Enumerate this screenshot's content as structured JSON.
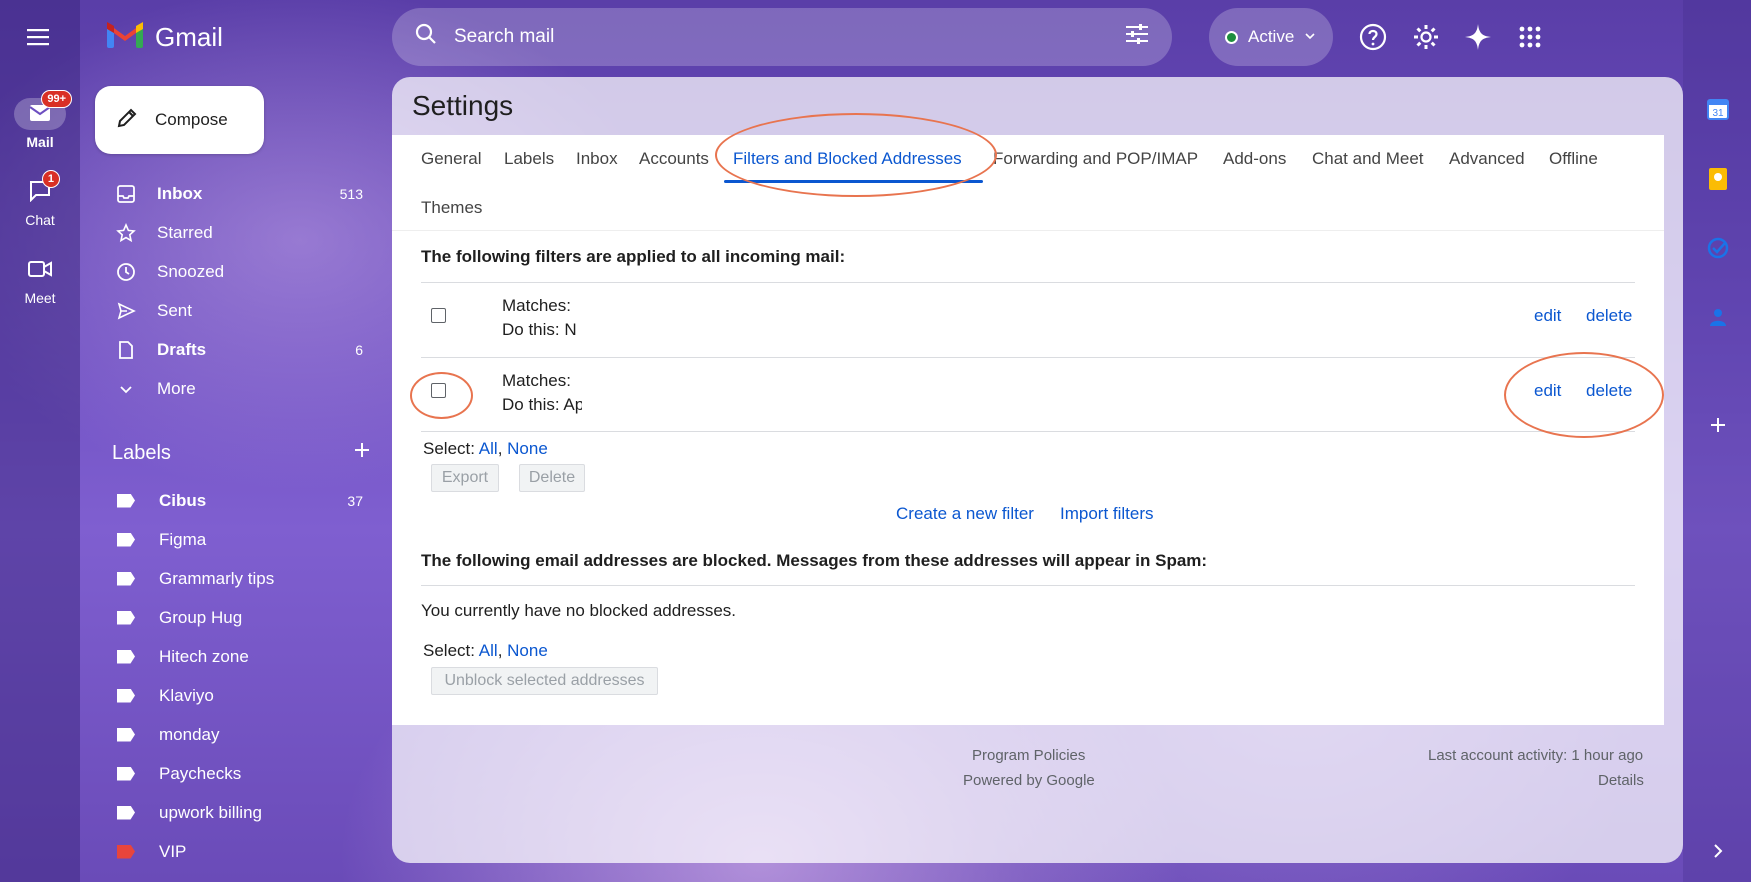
{
  "app": {
    "name": "Gmail"
  },
  "rail": {
    "items": [
      {
        "label": "Mail",
        "badge": "99+"
      },
      {
        "label": "Chat",
        "badge": "1"
      },
      {
        "label": "Meet"
      }
    ]
  },
  "compose": {
    "label": "Compose"
  },
  "nav": {
    "items": [
      {
        "label": "Inbox",
        "count": "513",
        "icon": "inbox-icon"
      },
      {
        "label": "Starred",
        "icon": "star-icon"
      },
      {
        "label": "Snoozed",
        "icon": "clock-icon"
      },
      {
        "label": "Sent",
        "icon": "send-icon"
      },
      {
        "label": "Drafts",
        "count": "6",
        "icon": "draft-icon"
      },
      {
        "label": "More",
        "icon": "chevron-down-icon"
      }
    ]
  },
  "labels": {
    "title": "Labels",
    "items": [
      {
        "label": "Cibus",
        "count": "37",
        "color": "#ffffff"
      },
      {
        "label": "Figma",
        "color": "#ffffff"
      },
      {
        "label": "Grammarly tips",
        "color": "#ffffff"
      },
      {
        "label": "Group Hug",
        "color": "#ffffff"
      },
      {
        "label": "Hitech zone",
        "color": "#ffffff"
      },
      {
        "label": "Klaviyo",
        "color": "#ffffff"
      },
      {
        "label": "monday",
        "color": "#ffffff"
      },
      {
        "label": "Paychecks",
        "color": "#ffffff"
      },
      {
        "label": "upwork billing",
        "color": "#ffffff"
      },
      {
        "label": "VIP",
        "color": "#e8453c"
      }
    ]
  },
  "search": {
    "placeholder": "Search mail"
  },
  "status": {
    "label": "Active",
    "color": "#1e8e3e"
  },
  "settings": {
    "title": "Settings",
    "tabs": [
      "General",
      "Labels",
      "Inbox",
      "Accounts",
      "Filters and Blocked Addresses",
      "Forwarding and POP/IMAP",
      "Add-ons",
      "Chat and Meet",
      "Advanced",
      "Offline",
      "Themes"
    ],
    "active_tab": "Filters and Blocked Addresses",
    "filters_heading": "The following filters are applied to all incoming mail:",
    "filters": [
      {
        "matches": "Matches: ",
        "action": "Do this: N",
        "edit": "edit",
        "delete": "delete"
      },
      {
        "matches": "Matches: ",
        "action": "Do this: Ap",
        "edit": "edit",
        "delete": "delete"
      }
    ],
    "select": {
      "prefix": "Select:",
      "all": "All",
      "sep": ",",
      "none": "None"
    },
    "export_label": "Export",
    "delete_label": "Delete",
    "create_filter": "Create a new filter",
    "import_filters": "Import filters",
    "blocked_heading": "The following email addresses are blocked. Messages from these addresses will appear in Spam:",
    "no_blocked": "You currently have no blocked addresses.",
    "unblock_label": "Unblock selected addresses"
  },
  "footer": {
    "program_policies": "Program Policies",
    "powered_by": "Powered by Google",
    "last_activity": "Last account activity: 1 hour ago",
    "details": "Details"
  },
  "accent_color": "#0b57d0",
  "annotation_color": "#e8744f"
}
